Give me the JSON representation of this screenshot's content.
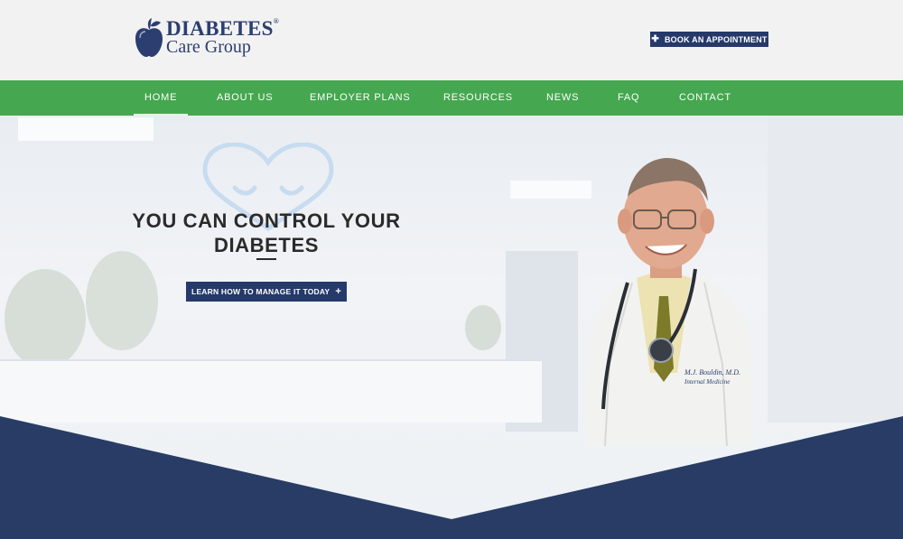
{
  "header": {
    "logo": {
      "line1": "DIABETES",
      "reg": "®",
      "line2": "Care Group"
    },
    "appointment_button": {
      "icon": "plus-icon",
      "label": "BOOK AN APPOINTMENT"
    }
  },
  "nav": {
    "items": [
      {
        "label": "HOME",
        "active": true
      },
      {
        "label": "ABOUT US"
      },
      {
        "label": "EMPLOYER PLANS"
      },
      {
        "label": "RESOURCES"
      },
      {
        "label": "NEWS"
      },
      {
        "label": "FAQ"
      },
      {
        "label": "CONTACT"
      }
    ]
  },
  "hero": {
    "title": "YOU CAN CONTROL YOUR DIABETES",
    "cta": {
      "label": "LEARN HOW TO MANAGE IT TODAY",
      "icon": "plus-icon"
    },
    "doctor_coat_text": [
      "M.J. Bouldin, M.D.",
      "Internal Medicine"
    ]
  },
  "colors": {
    "navy": "#25396a",
    "green": "#45a74f",
    "footer_navy": "#283c66"
  }
}
